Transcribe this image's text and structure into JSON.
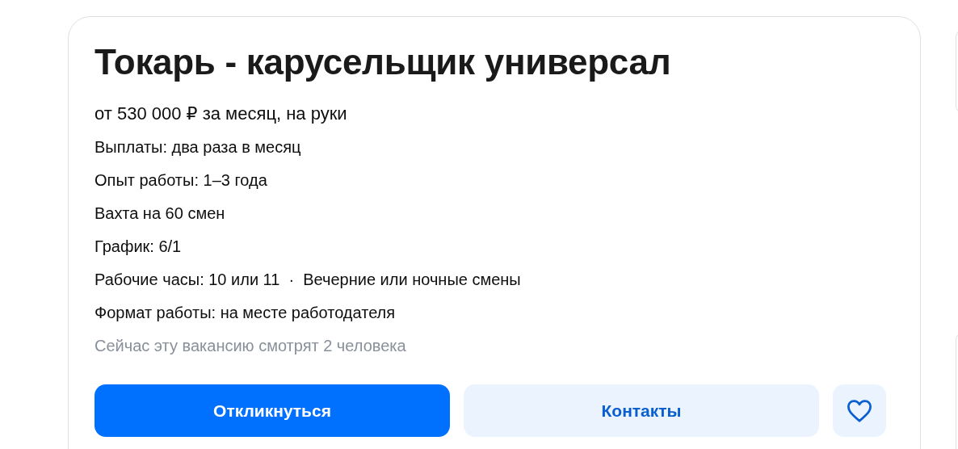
{
  "vacancy": {
    "title": "Токарь - карусельщик универсал",
    "salary": "от 530 000 ₽ за месяц, на руки",
    "details": [
      "Выплаты: два раза в месяц",
      "Опыт работы: 1–3 года",
      "Вахта на 60 смен",
      "График: 6/1",
      "Рабочие часы: 10 или 11  ·  Вечерние или ночные смены",
      "Формат работы: на месте работодателя"
    ],
    "viewers": "Сейчас эту вакансию смотрят 2 человека",
    "buttons": [
      {
        "kind": "primary",
        "label": "Откликнуться"
      },
      {
        "kind": "secondary",
        "label": "Контакты"
      }
    ],
    "favorite": {
      "on": false
    }
  }
}
